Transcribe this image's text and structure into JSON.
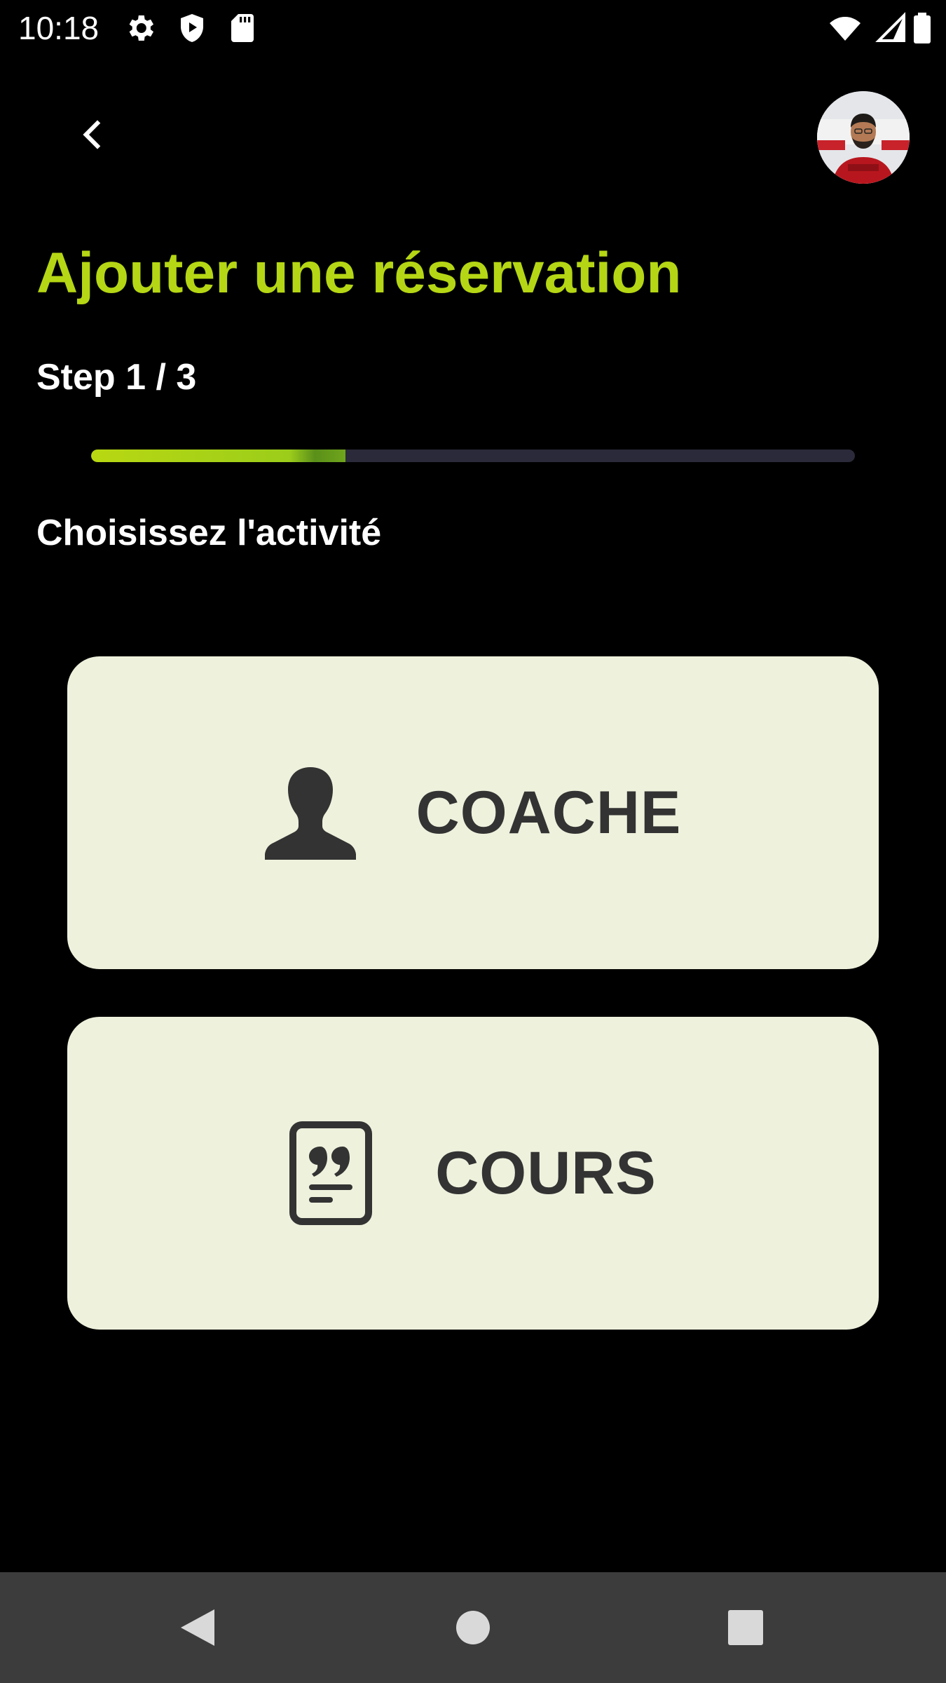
{
  "status_bar": {
    "time": "10:18",
    "left_icons": [
      "gear-icon",
      "shield-play-icon",
      "sd-card-icon"
    ],
    "right_icons": [
      "wifi-icon",
      "cell-signal-icon",
      "battery-icon"
    ]
  },
  "app_bar": {
    "back_icon": "chevron-left-icon",
    "avatar": "user-avatar"
  },
  "page": {
    "title": "Ajouter une réservation",
    "step": "Step 1 / 3",
    "progress": 0.333,
    "section_label": "Choisissez l'activité"
  },
  "options": [
    {
      "icon": "person-silhouette-icon",
      "label": "COACHE"
    },
    {
      "icon": "quote-document-icon",
      "label": "COURS"
    }
  ],
  "nav_bar": {
    "icons": [
      "nav-back-icon",
      "nav-home-icon",
      "nav-recents-icon"
    ]
  },
  "colors": {
    "accent": "#b5d614",
    "background": "#000000",
    "card": "#eef1dc",
    "card_text": "#333333",
    "progress_track": "#2a2a3a",
    "nav_bar": "#3c3c3c"
  }
}
